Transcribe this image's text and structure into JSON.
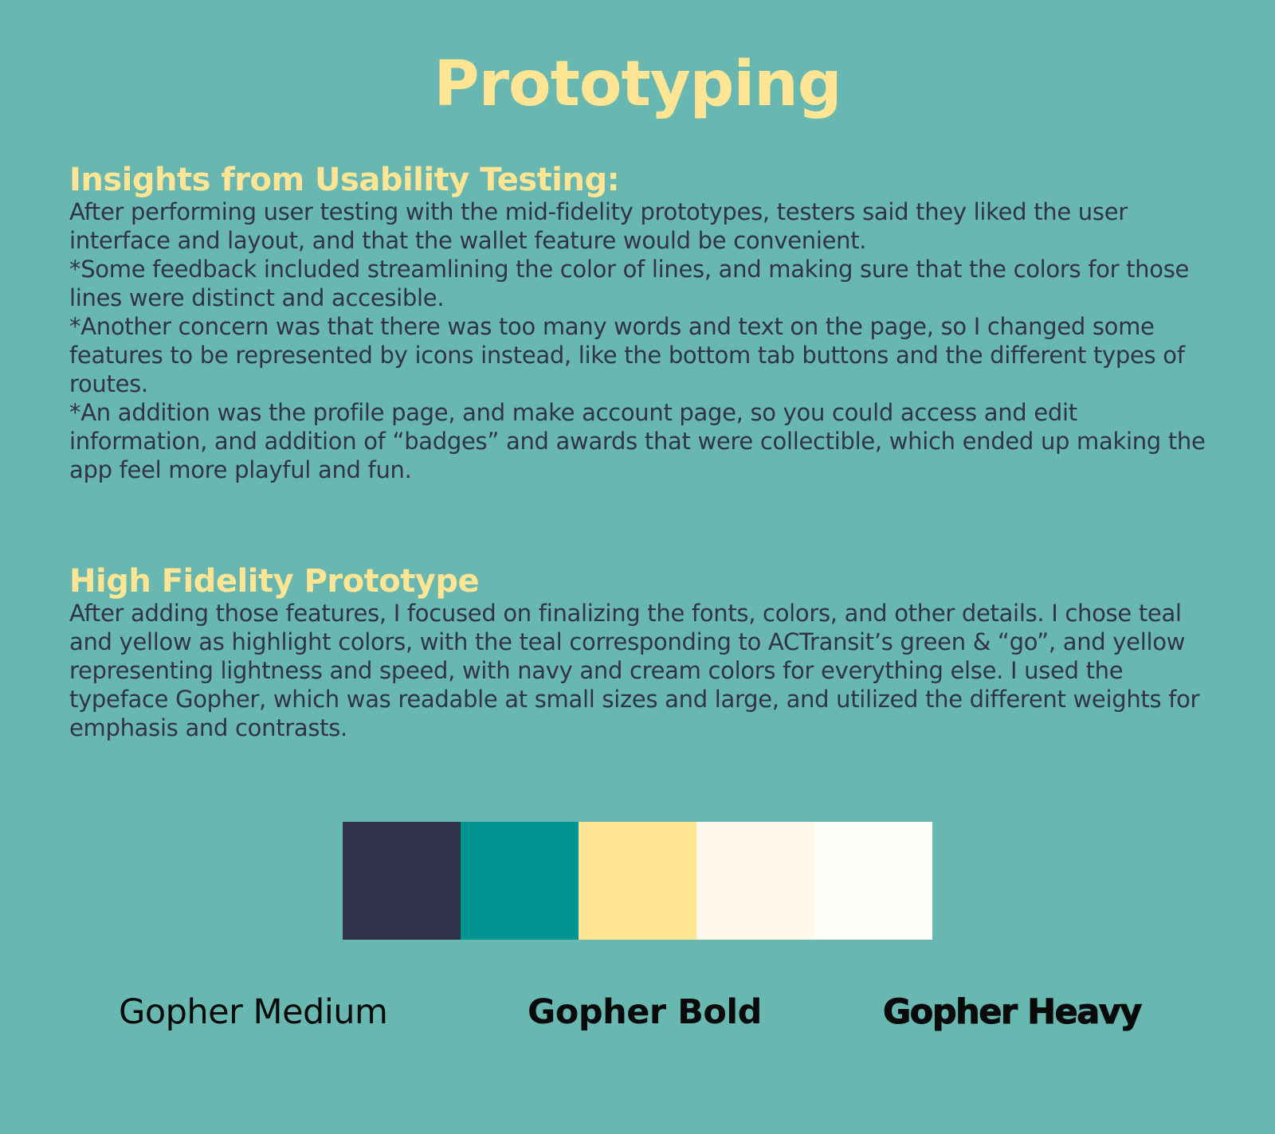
{
  "title": "Prototyping",
  "insights": {
    "heading": "Insights from Usability Testing:",
    "paragraphs": [
      "After performing user testing with the mid-fidelity prototypes, testers said they liked the user interface and layout, and that the wallet feature would be convenient.",
      "*Some feedback included streamlining the color of lines, and making sure that the colors for those lines were distinct and accesible.",
      "*Another concern was that there was too many words and text on the page, so I changed some features to be represented by icons instead, like the bottom tab buttons and the different types of routes.",
      "*An addition was the profile page, and make account page, so you could access and edit information, and addition of “badges” and awards that were collectible, which ended up making the app feel more playful and fun."
    ]
  },
  "hifi": {
    "heading": "High Fidelity Prototype",
    "paragraph": "After adding those features, I focused on finalizing the fonts, colors, and other details. I chose teal and yellow as highlight colors, with the teal corresponding to ACTransit’s green & “go”, and yellow representing lightness and speed, with navy and cream colors for everything else. I used the typeface Gopher, which was readable at small sizes and large, and utilized the different weights for emphasis and contrasts."
  },
  "palette": [
    "#30334a",
    "#009590",
    "#ffe594",
    "#fff8eb",
    "#fffdf7"
  ],
  "fonts": {
    "medium": "Gopher Medium",
    "bold": "Gopher Bold",
    "heavy": "Gopher Heavy"
  },
  "colors": {
    "background": "#68b7b1",
    "accent": "#ffe594",
    "text": "#30334a"
  }
}
